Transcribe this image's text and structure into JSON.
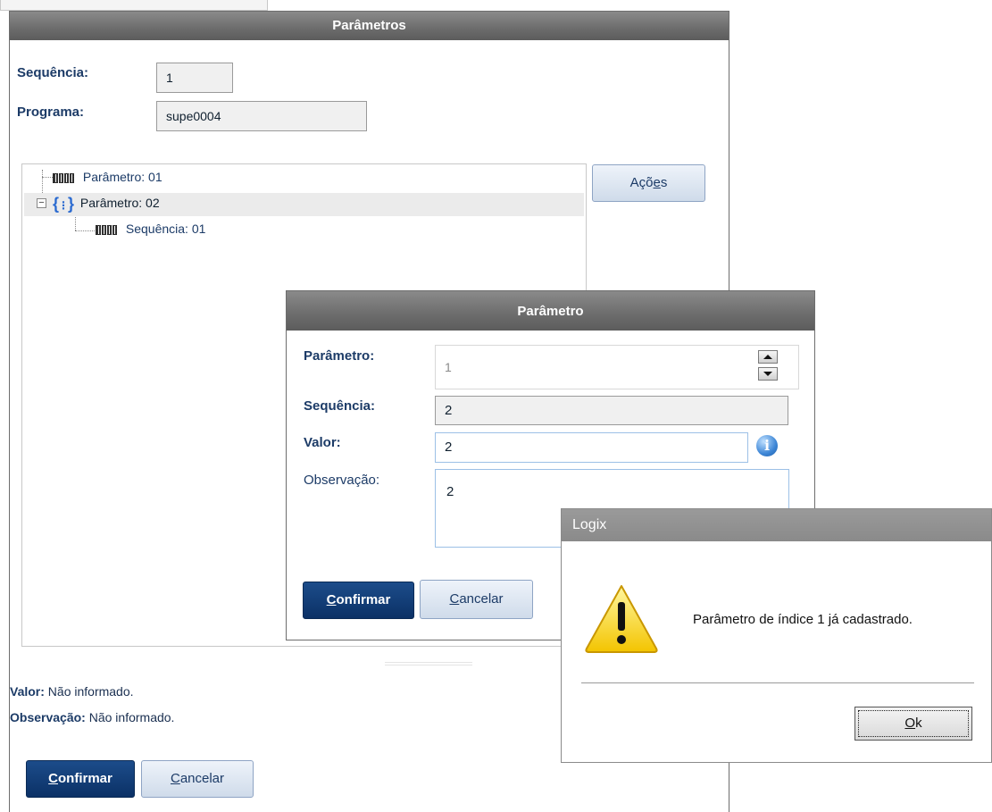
{
  "main": {
    "title": "Parâmetros",
    "sequencia_label": "Sequência:",
    "sequencia_value": "1",
    "programa_label": "Programa:",
    "programa_value": "supe0004",
    "acoes_pre": "Açõ",
    "acoes_u": "e",
    "acoes_post": "s",
    "tree": [
      {
        "label": "Parâmetro: 01"
      },
      {
        "label": "Parâmetro: 02"
      },
      {
        "label": "Sequência: 01"
      }
    ],
    "valor_label": "Valor:",
    "valor_text": "Não informado.",
    "observacao_label": "Observação:",
    "observacao_text": "Não informado.",
    "confirm_u": "C",
    "confirm_rest": "onfirmar",
    "cancel_u": "C",
    "cancel_rest": "ancelar"
  },
  "sub": {
    "title": "Parâmetro",
    "parametro_label": "Parâmetro:",
    "parametro_value": "1",
    "sequencia_label": "Sequência:",
    "sequencia_value": "2",
    "valor_label": "Valor:",
    "valor_value": "2",
    "observacao_label": "Observação:",
    "observacao_value": "2",
    "confirm_u": "C",
    "confirm_rest": "onfirmar",
    "cancel_u": "C",
    "cancel_rest": "ancelar"
  },
  "logix": {
    "title": "Logix",
    "message": "Parâmetro de índice 1 já cadastrado.",
    "ok_u": "O",
    "ok_rest": "k"
  },
  "colors": {
    "primary": "#0b3166",
    "label": "#1c3b67",
    "titlebar": "#6c6c6c"
  }
}
